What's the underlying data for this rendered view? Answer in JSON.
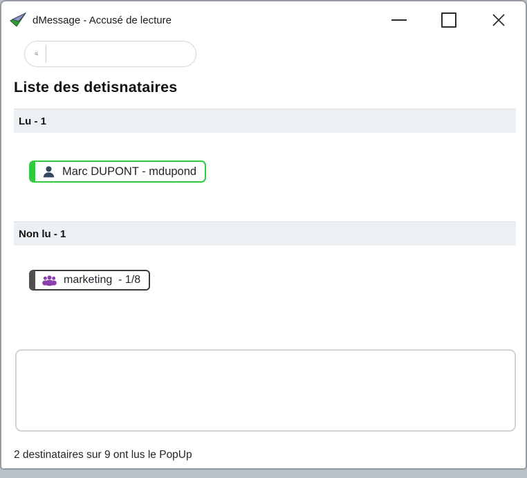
{
  "window": {
    "title": "dMessage - Accusé de lecture"
  },
  "search": {
    "value": "",
    "placeholder": ""
  },
  "heading": "Liste des detisnataires",
  "sections": [
    {
      "label": "Lu - 1",
      "items": [
        {
          "icon": "user-icon",
          "label": "Marc DUPONT - mdupond"
        }
      ]
    },
    {
      "label": "Non lu - 1",
      "items": [
        {
          "icon": "users-group-icon",
          "label": "marketing  - 1/8"
        }
      ]
    }
  ],
  "comment_box": {
    "value": ""
  },
  "status_text": "2 destinataires sur 9 ont lus le PopUp",
  "colors": {
    "read_accent": "#2fcb3e",
    "unread_accent": "#4f4f4f",
    "user_icon": "#34495e",
    "group_icon": "#8e3fae",
    "section_bg": "#edf0f2",
    "window_border": "#939aa1",
    "desktop_band": "#b9c0c7"
  }
}
